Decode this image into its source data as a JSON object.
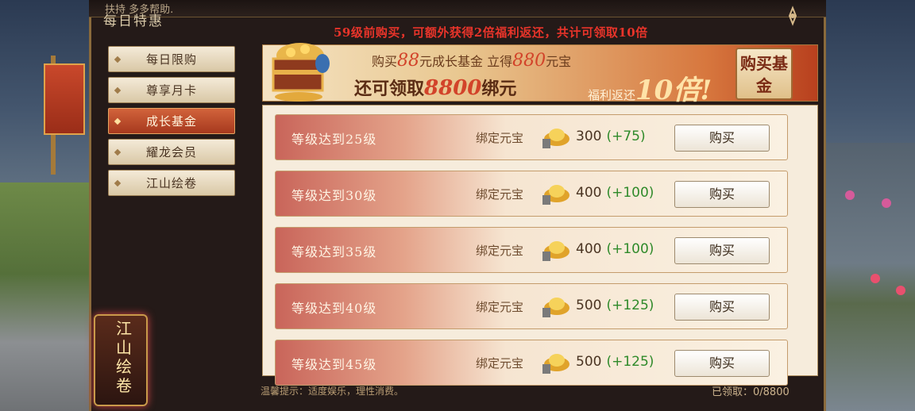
{
  "header": {
    "title": "每日特惠",
    "top_hint": "扶持    多多帮助."
  },
  "sidebar": {
    "items": [
      {
        "label": "每日限购",
        "active": false
      },
      {
        "label": "尊享月卡",
        "active": false
      },
      {
        "label": "成长基金",
        "active": true
      },
      {
        "label": "耀龙会员",
        "active": false
      },
      {
        "label": "江山绘卷",
        "active": false
      }
    ],
    "badge_text": "江山绘卷"
  },
  "promo": {
    "headline": "59级前购买，可额外获得2倍福利返还，共计可领取10倍",
    "line1_pre": "购买",
    "line1_amount": "88",
    "line1_mid": "元成长基金  立得",
    "line1_reward": "880",
    "line1_post": "元宝",
    "line2_pre": "还可领取",
    "line2_amount": "8800",
    "line2_post": "绑元",
    "bonus_pre": "福利返还",
    "bonus_big": "10倍!",
    "buy_fund_label": "购买基金"
  },
  "rows": [
    {
      "label": "等级达到25级",
      "currency": "绑定元宝",
      "amount": "300",
      "bonus": "(+75)",
      "button": "购买"
    },
    {
      "label": "等级达到30级",
      "currency": "绑定元宝",
      "amount": "400",
      "bonus": "(+100)",
      "button": "购买"
    },
    {
      "label": "等级达到35级",
      "currency": "绑定元宝",
      "amount": "400",
      "bonus": "(+100)",
      "button": "购买"
    },
    {
      "label": "等级达到40级",
      "currency": "绑定元宝",
      "amount": "500",
      "bonus": "(+125)",
      "button": "购买"
    },
    {
      "label": "等级达到45级",
      "currency": "绑定元宝",
      "amount": "500",
      "bonus": "(+125)",
      "button": "购买"
    }
  ],
  "footer": {
    "tip": "温馨提示：适度娱乐，理性消费。",
    "claimed": "已领取：0/8800"
  },
  "colors": {
    "accent_red": "#e8342a",
    "bonus_green": "#2f8a2a",
    "active_tab": "#c04a28"
  }
}
